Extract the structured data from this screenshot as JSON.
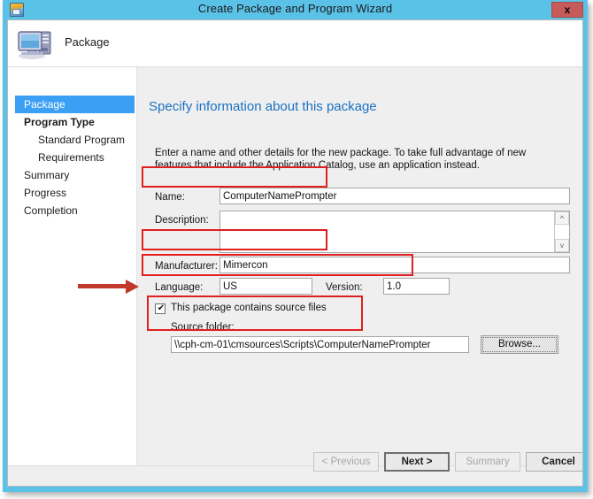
{
  "window": {
    "title": "Create Package and Program Wizard",
    "close_label": "x",
    "title_icon": "package-wizard-icon",
    "frame_color": "#5bc2e7",
    "close_color": "#c75b5b"
  },
  "header": {
    "title": "Package",
    "icon": "computer-icon"
  },
  "sidebar": {
    "items": [
      {
        "label": "Package",
        "selected": true,
        "bold": false,
        "indent": false
      },
      {
        "label": "Program Type",
        "selected": false,
        "bold": true,
        "indent": false
      },
      {
        "label": "Standard Program",
        "selected": false,
        "bold": false,
        "indent": true
      },
      {
        "label": "Requirements",
        "selected": false,
        "bold": false,
        "indent": true
      },
      {
        "label": "Summary",
        "selected": false,
        "bold": false,
        "indent": false
      },
      {
        "label": "Progress",
        "selected": false,
        "bold": false,
        "indent": false
      },
      {
        "label": "Completion",
        "selected": false,
        "bold": false,
        "indent": false
      }
    ],
    "selected_color": "#3b9ff3"
  },
  "main": {
    "heading": "Specify information about this package",
    "heading_color": "#1a72c4",
    "description": "Enter a name and other details for the new package. To take full advantage of new features that include the Application Catalog, use an application instead.",
    "fields": {
      "name_label": "Name:",
      "name_value": "ComputerNamePrompter",
      "description_label": "Description:",
      "description_value": "",
      "manufacturer_label": "Manufacturer:",
      "manufacturer_value": "Mimercon",
      "language_label": "Language:",
      "language_value": "US",
      "version_label": "Version:",
      "version_value": "1.0"
    },
    "source": {
      "checkbox_label": "This package contains source files",
      "checkbox_checked": true,
      "folder_label": "Source folder:",
      "folder_value": "\\\\cph-cm-01\\cmsources\\Scripts\\ComputerNamePrompter",
      "browse_label": "Browse..."
    },
    "scroll_up_icon": "chevron-up-icon",
    "scroll_down_icon": "chevron-down-icon"
  },
  "footer": {
    "previous_label": "< Previous",
    "previous_enabled": false,
    "next_label": "Next >",
    "next_enabled": true,
    "summary_label": "Summary",
    "summary_enabled": false,
    "cancel_label": "Cancel",
    "cancel_enabled": true
  },
  "annotations": {
    "color": "#e02020",
    "arrow_color": "#c0392b"
  }
}
